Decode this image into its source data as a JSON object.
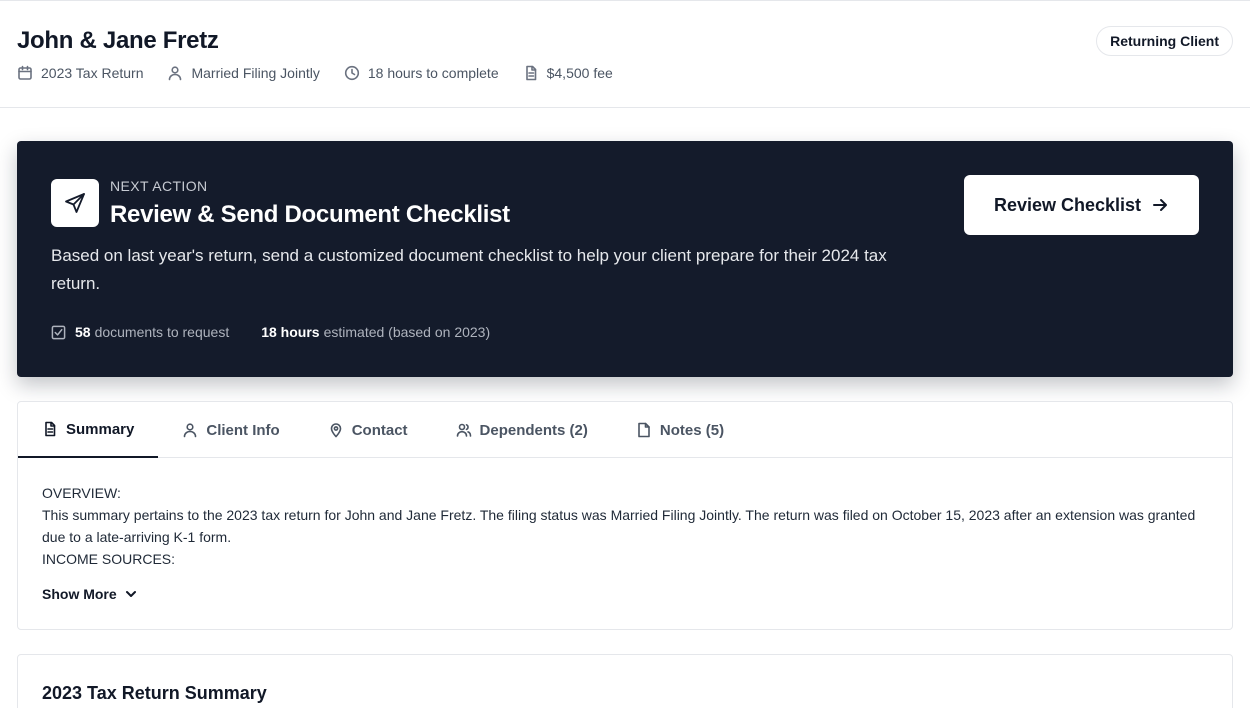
{
  "client": {
    "name": "John & Jane Fretz",
    "badge": "Returning Client",
    "meta": {
      "tax_year": "2023 Tax Return",
      "filing_status": "Married Filing Jointly",
      "time": "18 hours to complete",
      "fee": "$4,500 fee"
    }
  },
  "next_action": {
    "eyebrow": "NEXT ACTION",
    "title": "Review & Send Document Checklist",
    "description": "Based on last year's return, send a customized document checklist to help your client prepare for their 2024 tax return.",
    "documents_count": "58",
    "documents_label": "documents to request",
    "hours": "18 hours",
    "hours_label": "estimated (based on 2023)",
    "button_label": "Review Checklist"
  },
  "tabs": [
    {
      "label": "Summary",
      "icon": "document-icon",
      "active": true
    },
    {
      "label": "Client Info",
      "icon": "user-icon"
    },
    {
      "label": "Contact",
      "icon": "map-pin-icon"
    },
    {
      "label": "Dependents (2)",
      "icon": "users-icon"
    },
    {
      "label": "Notes (5)",
      "icon": "note-icon"
    }
  ],
  "summary": {
    "overview_heading": "OVERVIEW:",
    "overview_text": "This summary pertains to the 2023 tax return for John and Jane Fretz. The filing status was Married Filing Jointly. The return was filed on October 15, 2023 after an extension was granted due to a late-arriving K-1 form.",
    "income_heading": "INCOME SOURCES:",
    "show_more": "Show More"
  },
  "return_summary": {
    "title": "2023 Tax Return Summary"
  }
}
